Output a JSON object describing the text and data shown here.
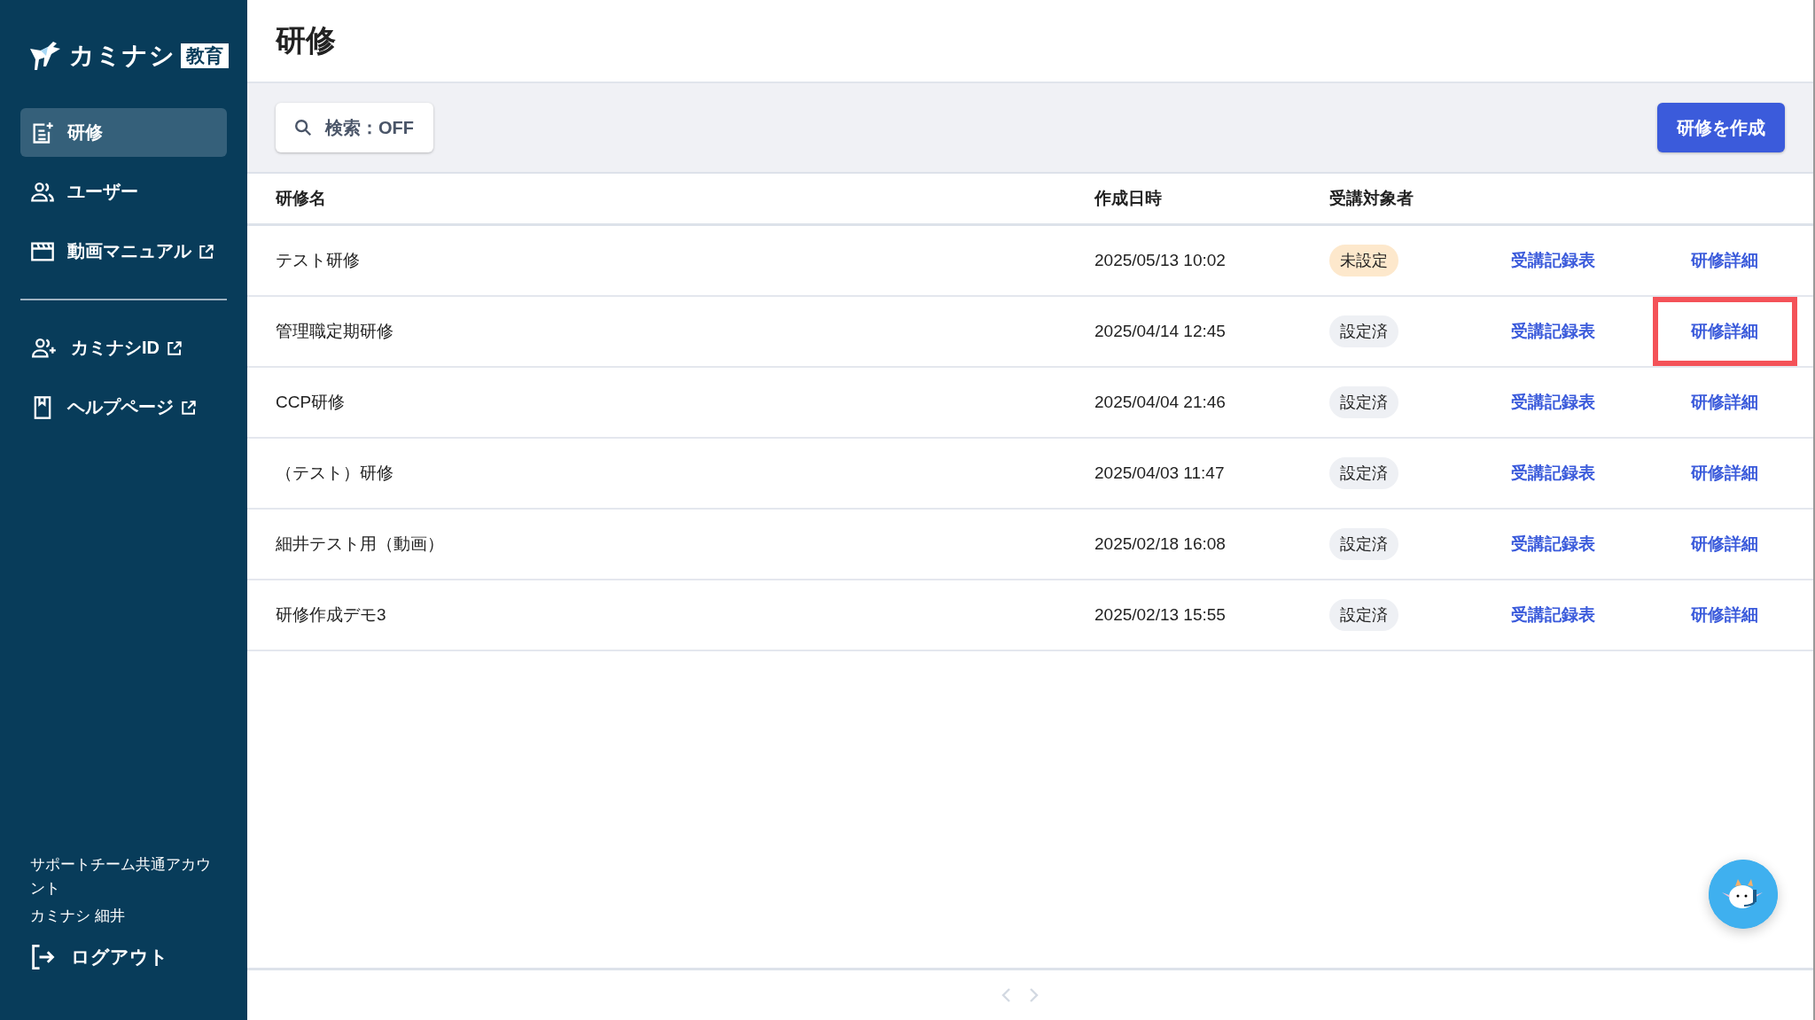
{
  "sidebar": {
    "logo": {
      "name": "カミナシ",
      "badge": "教育"
    },
    "items": [
      {
        "label": "研修",
        "selected": true,
        "external": false
      },
      {
        "label": "ユーザー",
        "selected": false,
        "external": false
      },
      {
        "label": "動画マニュアル",
        "selected": false,
        "external": true
      }
    ],
    "secondary_items": [
      {
        "label": "カミナシID",
        "external": true
      },
      {
        "label": "ヘルプページ",
        "external": true
      }
    ],
    "account": {
      "team": "サポートチーム共通アカウント",
      "user": "カミナシ 細井"
    },
    "logout": "ログアウト"
  },
  "page_title": "研修",
  "toolbar": {
    "search_toggle": "検索：OFF",
    "create_button": "研修を作成"
  },
  "table": {
    "columns": [
      "研修名",
      "作成日時",
      "受講対象者"
    ],
    "rows": [
      {
        "name": "テスト研修",
        "created": "2025/05/13 10:02",
        "target": {
          "label": "未設定",
          "color": "#fde8cc"
        },
        "record_link": "受講記録表",
        "detail_link": "研修詳細",
        "highlighted": false
      },
      {
        "name": "管理職定期研修",
        "created": "2025/04/14 12:45",
        "target": {
          "label": "設定済",
          "color": "#eef0f4"
        },
        "record_link": "受講記録表",
        "detail_link": "研修詳細",
        "highlighted": true
      },
      {
        "name": "CCP研修",
        "created": "2025/04/04 21:46",
        "target": {
          "label": "設定済",
          "color": "#eef0f4"
        },
        "record_link": "受講記録表",
        "detail_link": "研修詳細",
        "highlighted": false
      },
      {
        "name": "（テスト）研修",
        "created": "2025/04/03 11:47",
        "target": {
          "label": "設定済",
          "color": "#eef0f4"
        },
        "record_link": "受講記録表",
        "detail_link": "研修詳細",
        "highlighted": false
      },
      {
        "name": "細井テスト用（動画）",
        "created": "2025/02/18 16:08",
        "target": {
          "label": "設定済",
          "color": "#eef0f4"
        },
        "record_link": "受講記録表",
        "detail_link": "研修詳細",
        "highlighted": false
      },
      {
        "name": "研修作成デモ3",
        "created": "2025/02/13 15:55",
        "target": {
          "label": "設定済",
          "color": "#eef0f4"
        },
        "record_link": "受講記録表",
        "detail_link": "研修詳細",
        "highlighted": false
      }
    ]
  },
  "pagination": {
    "previous": {
      "disabled": true
    },
    "next": {
      "disabled": true
    }
  }
}
